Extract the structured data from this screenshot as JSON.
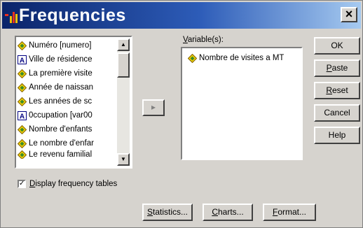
{
  "window": {
    "title": "Frequencies",
    "close_symbol": "×"
  },
  "source_list": {
    "items": [
      {
        "label": "Numéro [numero]",
        "icon": "scale-variable-icon"
      },
      {
        "label": "Ville de résidence",
        "icon": "string-variable-icon"
      },
      {
        "label": "La première visite",
        "icon": "scale-variable-icon"
      },
      {
        "label": "Année de naissan",
        "icon": "scale-variable-icon"
      },
      {
        "label": "Les années de sc",
        "icon": "scale-variable-icon"
      },
      {
        "label": "0ccupation [var00",
        "icon": "string-variable-icon"
      },
      {
        "label": "Nombre d'enfants",
        "icon": "scale-variable-icon"
      },
      {
        "label": "Le nombre d'enfar",
        "icon": "scale-variable-icon"
      },
      {
        "label": "Le revenu familial",
        "icon": "scale-variable-icon"
      }
    ],
    "scroll_up": "▲",
    "scroll_down": "▼"
  },
  "transfer_button": {
    "label": "▸"
  },
  "variables": {
    "label_first": "V",
    "label_rest": "ariable(s):",
    "items": [
      {
        "label": "Nombre de visites a MT",
        "icon": "scale-variable-icon"
      }
    ]
  },
  "side_buttons": {
    "ok": {
      "label": "OK",
      "key": "",
      "rest": "OK"
    },
    "paste": {
      "key": "P",
      "rest": "aste"
    },
    "reset": {
      "key": "R",
      "rest": "eset"
    },
    "cancel": {
      "label": "Cancel"
    },
    "help": {
      "label": "Help"
    }
  },
  "display_checkbox": {
    "checked": true,
    "check_mark": "✓",
    "key": "D",
    "rest": "isplay frequency tables"
  },
  "bottom_buttons": {
    "statistics": {
      "key": "S",
      "rest": "tatistics..."
    },
    "charts": {
      "key": "C",
      "rest": "harts..."
    },
    "format": {
      "key": "F",
      "rest": "ormat..."
    }
  },
  "colors": {
    "title_gradient_start": "#0a246a",
    "title_gradient_end": "#a6caf0",
    "dialog_face": "#d6d3ce"
  }
}
